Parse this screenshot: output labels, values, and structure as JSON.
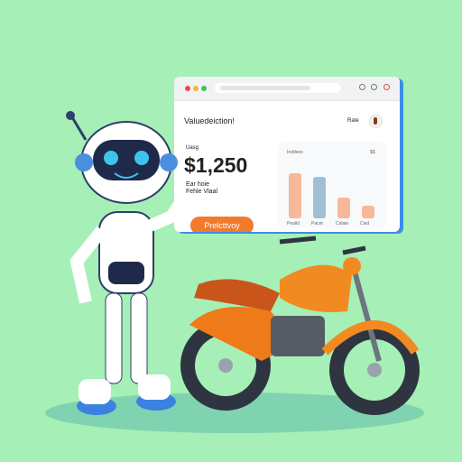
{
  "window": {
    "title": "Valuedeiction!",
    "header_right": "Rate",
    "value_label": "Uasg",
    "price": "$1,250",
    "subtext_line1": "Ear hoie",
    "subtext_line2": "Fehle Vlaal",
    "button_label": "Prelcttvoy",
    "window_controls": [
      "#ee4b4b",
      "#f5b731",
      "#3cc35a"
    ]
  },
  "chart_data": {
    "type": "bar",
    "title": "Inddees",
    "corner_label": "$$",
    "categories": [
      "Pealld",
      "Pacet",
      "Cnlaie",
      "Cwd"
    ],
    "values": [
      55,
      50,
      25,
      15
    ],
    "colors": [
      "#f7b79a",
      "#9fbfd6",
      "#f7b79a",
      "#f7b79a"
    ]
  },
  "colors": {
    "background": "#a6efb6",
    "accent": "#f27a2a",
    "window_edge": "#3b8ee8"
  }
}
